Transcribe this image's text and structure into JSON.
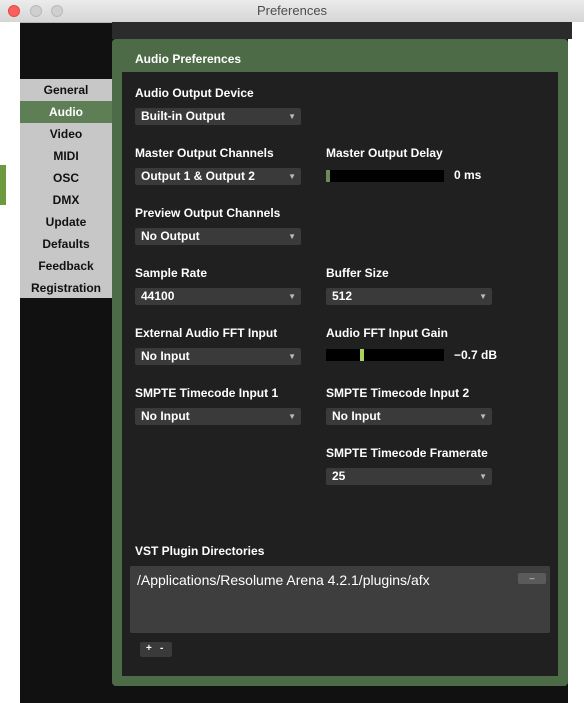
{
  "window": {
    "title": "Preferences"
  },
  "sidebar": {
    "items": [
      {
        "label": "General"
      },
      {
        "label": "Audio"
      },
      {
        "label": "Video"
      },
      {
        "label": "MIDI"
      },
      {
        "label": "OSC"
      },
      {
        "label": "DMX"
      },
      {
        "label": "Update"
      },
      {
        "label": "Defaults"
      },
      {
        "label": "Feedback"
      },
      {
        "label": "Registration"
      }
    ],
    "active": "Audio"
  },
  "panel": {
    "title": "Audio Preferences",
    "output_device": {
      "label": "Audio Output Device",
      "value": "Built-in Output"
    },
    "master_channels": {
      "label": "Master Output Channels",
      "value": "Output 1 & Output 2"
    },
    "master_delay": {
      "label": "Master Output Delay",
      "value": "0 ms",
      "level": 0.0
    },
    "preview_channels": {
      "label": "Preview Output Channels",
      "value": "No Output"
    },
    "sample_rate": {
      "label": "Sample Rate",
      "value": "44100"
    },
    "buffer_size": {
      "label": "Buffer Size",
      "value": "512"
    },
    "fft_input": {
      "label": "External Audio FFT Input",
      "value": "No Input"
    },
    "fft_gain": {
      "label": "Audio FFT Input Gain",
      "value": "−0.7 dB",
      "level": 0.3
    },
    "smpte1": {
      "label": "SMPTE Timecode Input 1",
      "value": "No Input"
    },
    "smpte2": {
      "label": "SMPTE Timecode Input 2",
      "value": "No Input"
    },
    "smpte_framerate": {
      "label": "SMPTE Timecode Framerate",
      "value": "25"
    },
    "vst": {
      "label": "VST Plugin Directories",
      "paths": [
        "/Applications/Resolume Arena 4.2.1/plugins/afx"
      ],
      "remove_label": "–",
      "add_label": "+",
      "minus_label": "-"
    }
  },
  "colors": {
    "panel_green": "#4d6b47",
    "active_item": "#5e7f56",
    "meter_green": "#a9d25c"
  }
}
